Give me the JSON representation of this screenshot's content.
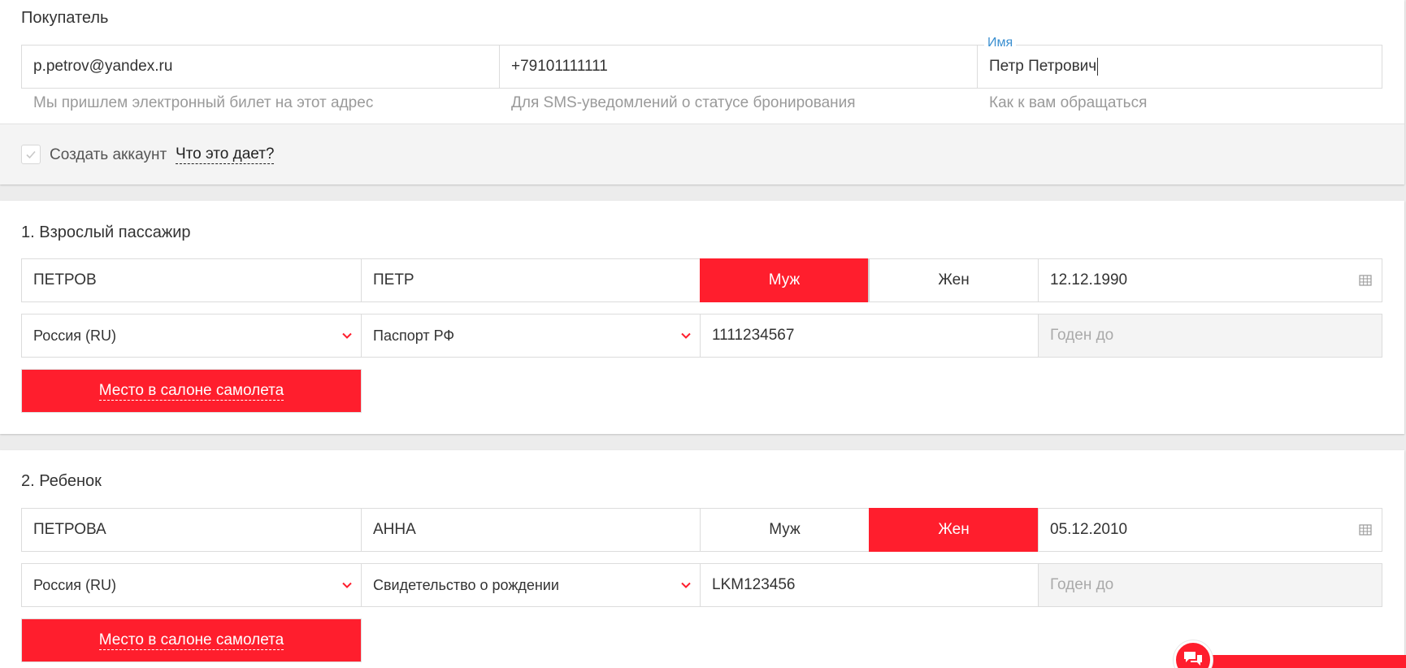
{
  "buyer": {
    "title": "Покупатель",
    "email": "p.petrov@yandex.ru",
    "email_hint": "Мы пришлем электронный билет на этот адрес",
    "phone": "+79101111111",
    "phone_hint": "Для SMS-уведомлений о статусе бронирования",
    "name_label": "Имя",
    "name": "Петр Петрович",
    "name_hint": "Как к вам обращаться",
    "create_account_label": "Создать аккаунт",
    "create_account_checked": true,
    "what_gives_link": "Что это дает?"
  },
  "passengers": [
    {
      "title": "1. Взрослый пассажир",
      "last_name": "ПЕТРОВ",
      "first_name": "ПЕТР",
      "gender_male": "Муж",
      "gender_female": "Жен",
      "selected_gender": "male",
      "birth_date": "12.12.1990",
      "citizenship": "Россия (RU)",
      "document_type": "Паспорт РФ",
      "document_number": "1111234567",
      "valid_until_placeholder": "Годен до",
      "seat_button": "Место в салоне самолета"
    },
    {
      "title": "2. Ребенок",
      "last_name": "ПЕТРОВА",
      "first_name": "АННА",
      "gender_male": "Муж",
      "gender_female": "Жен",
      "selected_gender": "female",
      "birth_date": "05.12.2010",
      "citizenship": "Россия (RU)",
      "document_type": "Свидетельство о рождении",
      "document_number": "LKM123456",
      "valid_until_placeholder": "Годен до",
      "seat_button": "Место в салоне самолета"
    }
  ],
  "icons": {
    "dropdown": "chevron-down-icon",
    "calendar": "calendar-icon",
    "chat": "chat-icon",
    "checkbox": "check-icon"
  },
  "colors": {
    "accent": "#ff1e2d",
    "label_blue": "#3a8fd0",
    "hint_gray": "#9a9a9a"
  }
}
